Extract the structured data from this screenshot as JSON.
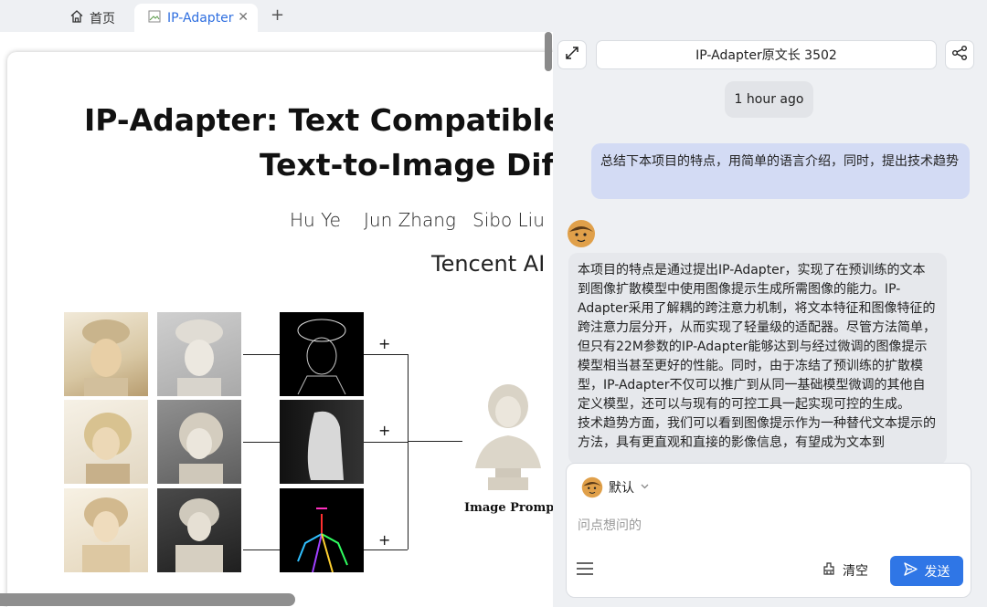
{
  "tabs": {
    "home_label": "首页",
    "active_label": "IP-Adapter"
  },
  "paper": {
    "title_line1": "IP-Adapter: Text Compatible Ir",
    "title_line2": "Text-to-Image Diff",
    "authors": [
      "Hu Ye",
      "Jun Zhang",
      "Sibo Liu"
    ],
    "affiliation": "Tencent AI",
    "image_prompt_label": "Image Prompt",
    "plus_signs": [
      "+",
      "+",
      "+"
    ]
  },
  "chat": {
    "doc_title": "IP-Adapter原文长 3502",
    "timestamp": "1 hour ago",
    "user_message": "总结下本项目的特点，用简单的语言介绍，同时，提出技术趋势",
    "bot_message_p1": "本项目的特点是通过提出IP-Adapter，实现了在预训练的文本到图像扩散模型中使用图像提示生成所需图像的能力。IP-Adapter采用了解耦的跨注意力机制，将文本特征和图像特征的跨注意力层分开，从而实现了轻量级的适配器。尽管方法简单，但只有22M参数的IP-Adapter能够达到与经过微调的图像提示模型相当甚至更好的性能。同时，由于冻结了预训练的扩散模型，IP-Adapter不仅可以推广到从同一基础模型微调的其他自定义模型，还可以与现有的可控工具一起实现可控的生成。",
    "bot_message_p2": "技术趋势方面，我们可以看到图像提示作为一种替代文本提示的方法，具有更直观和直接的影像信息，有望成为文本到",
    "persona_label": "默认",
    "input_placeholder": "问点想问的",
    "clear_label": "清空",
    "send_label": "发送"
  },
  "colors": {
    "accent": "#2f76e6",
    "user_bubble": "#d3dbf4",
    "bot_bubble": "#e6e8ec",
    "panel_bg": "#eef0f3"
  }
}
